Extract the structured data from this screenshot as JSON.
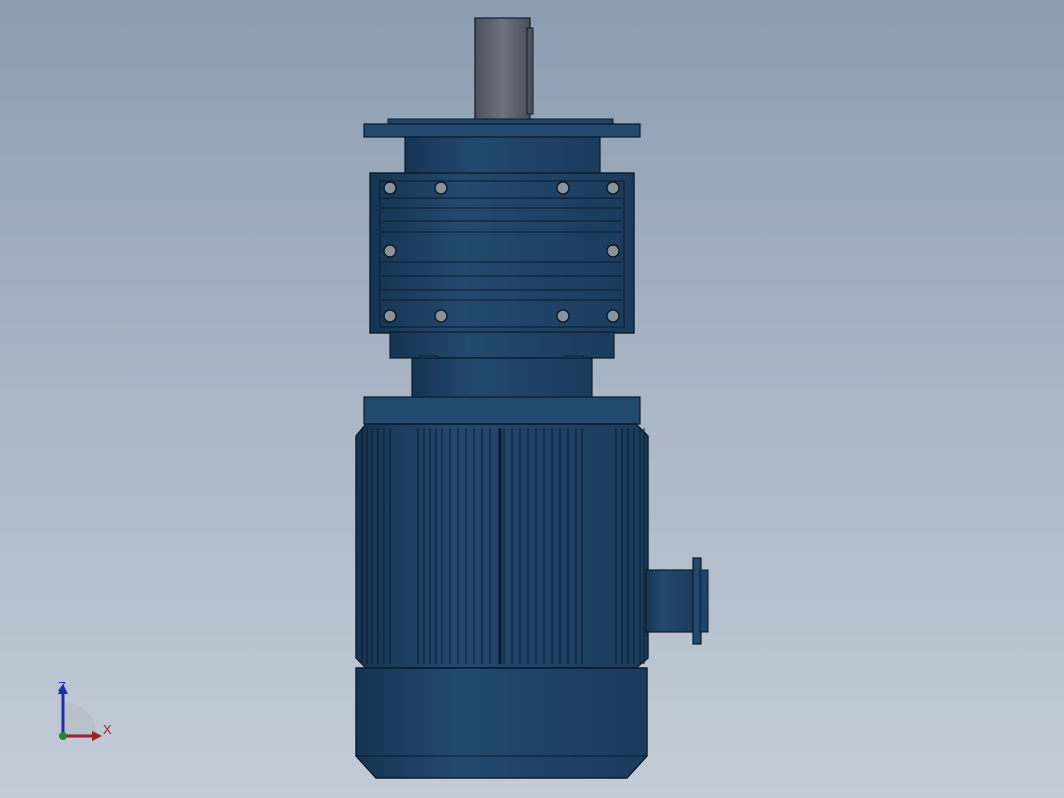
{
  "viewport": {
    "background_top": "#8c9db1",
    "background_bottom": "#c4ccd8"
  },
  "model": {
    "name": "gear-motor",
    "body_color": "#1f4467",
    "edge_color": "#0b1a2a",
    "shaft_color": "#5e6670",
    "bolt_color": "#8a929b"
  },
  "triad": {
    "z_label": "Z",
    "x_label": "X",
    "z_color": "#1f2fa8",
    "x_color": "#a0202a",
    "origin_color": "#1e8a3c"
  }
}
